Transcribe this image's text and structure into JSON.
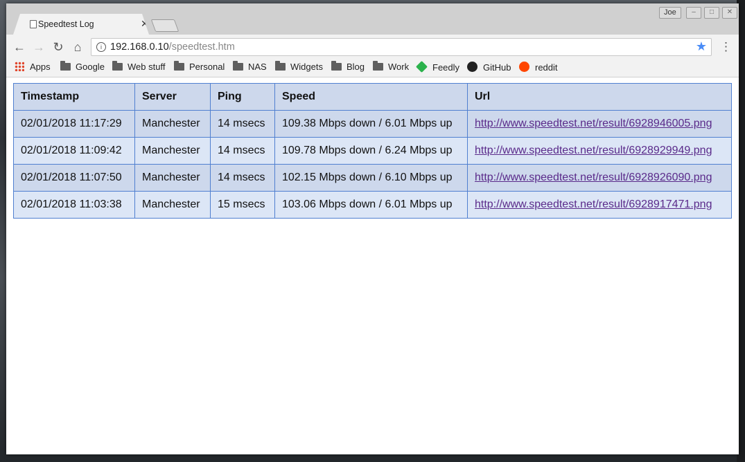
{
  "window": {
    "tab_title": "Speedtest Log",
    "profile_name": "Joe"
  },
  "toolbar": {
    "url_host": "192.168.0.10",
    "url_path": "/speedtest.htm"
  },
  "bookmarks": [
    {
      "label": "Apps",
      "icon": "apps-grid-icon"
    },
    {
      "label": "Google",
      "icon": "folder-icon"
    },
    {
      "label": "Web stuff",
      "icon": "folder-icon"
    },
    {
      "label": "Personal",
      "icon": "folder-icon"
    },
    {
      "label": "NAS",
      "icon": "folder-icon"
    },
    {
      "label": "Widgets",
      "icon": "folder-icon"
    },
    {
      "label": "Blog",
      "icon": "folder-icon"
    },
    {
      "label": "Work",
      "icon": "folder-icon"
    },
    {
      "label": "Feedly",
      "icon": "feedly-icon"
    },
    {
      "label": "GitHub",
      "icon": "github-icon"
    },
    {
      "label": "reddit",
      "icon": "reddit-icon"
    }
  ],
  "table": {
    "headers": [
      "Timestamp",
      "Server",
      "Ping",
      "Speed",
      "Url"
    ],
    "rows": [
      [
        "02/01/2018 11:17:29",
        "Manchester",
        "14 msecs",
        "109.38 Mbps down / 6.01 Mbps up",
        "http://www.speedtest.net/result/6928946005.png"
      ],
      [
        "02/01/2018 11:09:42",
        "Manchester",
        "14 msecs",
        "109.78 Mbps down / 6.24 Mbps up",
        "http://www.speedtest.net/result/6928929949.png"
      ],
      [
        "02/01/2018 11:07:50",
        "Manchester",
        "14 msecs",
        "102.15 Mbps down / 6.10 Mbps up",
        "http://www.speedtest.net/result/6928926090.png"
      ],
      [
        "02/01/2018 11:03:38",
        "Manchester",
        "15 msecs",
        "103.06 Mbps down / 6.01 Mbps up",
        "http://www.speedtest.net/result/6928917471.png"
      ]
    ]
  },
  "colors": {
    "header_bg": "#cdd8ec",
    "row_alt_bg": "#dce6f6",
    "border": "#4f7fd0",
    "link": "#5a2a8a"
  }
}
